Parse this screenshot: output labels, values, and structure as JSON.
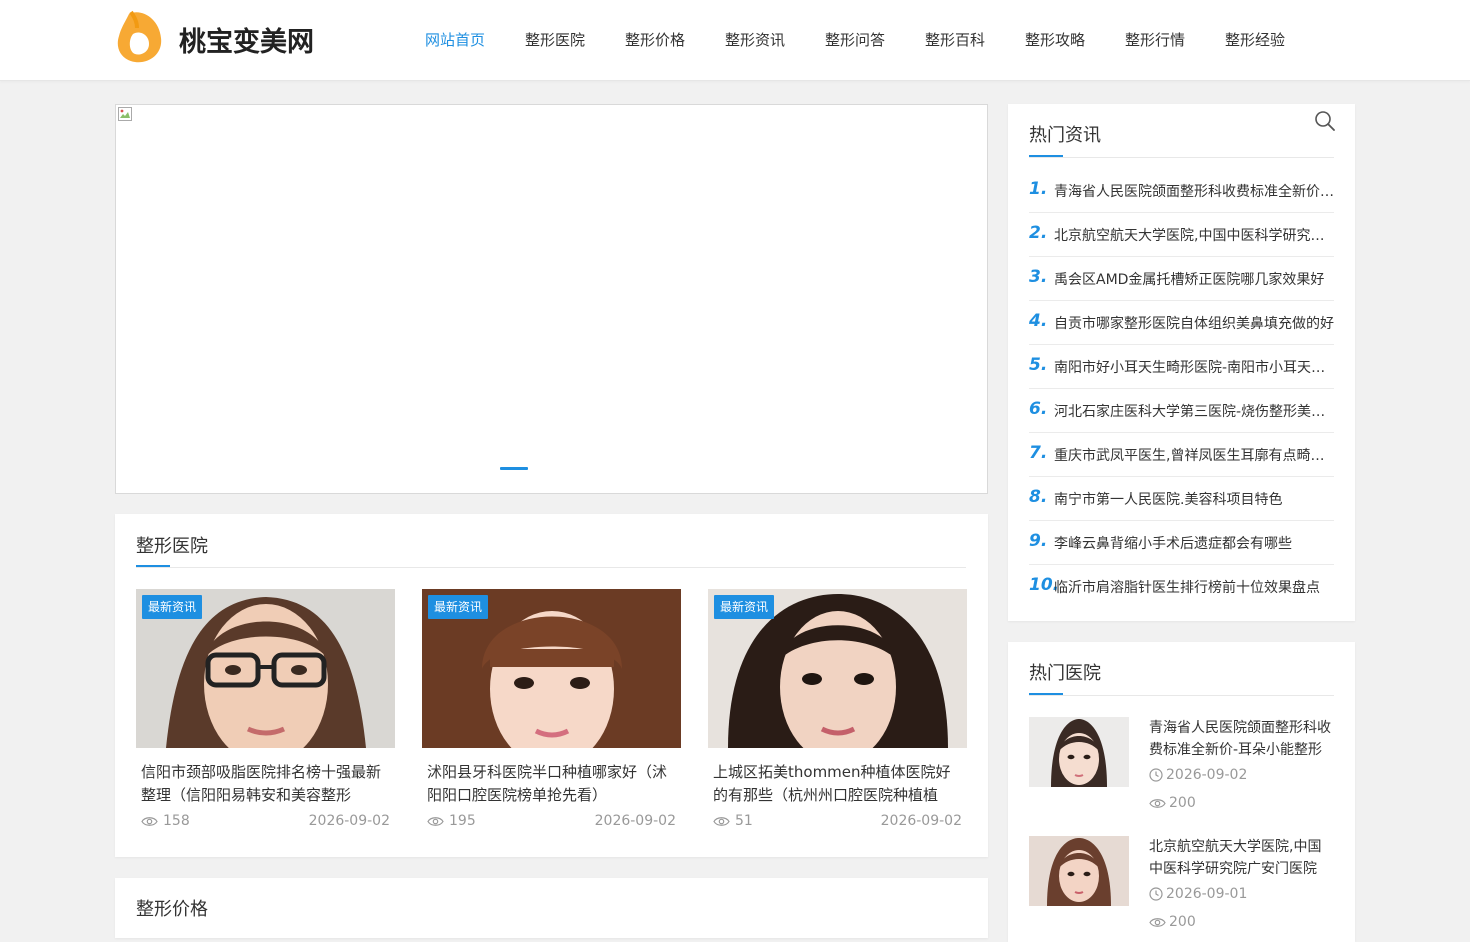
{
  "header": {
    "logo_text": "桃宝变美网",
    "nav": [
      "网站首页",
      "整形医院",
      "整形价格",
      "整形资讯",
      "整形问答",
      "整形百科",
      "整形攻略",
      "整形行情",
      "整形经验"
    ],
    "active_nav": 0
  },
  "colors": {
    "accent": "#1e8fe1",
    "logo_orange": "#f7a934",
    "background": "#f1f1f1"
  },
  "slider": {
    "active_slide": 1
  },
  "hospital_section": {
    "title": "整形医院",
    "articles": [
      {
        "tag": "最新资讯",
        "title": "信阳市颈部吸脂医院排名榜十强最新整理（信阳阳易韩安和美容整形",
        "views": "158",
        "date": "2026-09-02"
      },
      {
        "tag": "最新资讯",
        "title": "沭阳县牙科医院半口种植哪家好（沭阳阳口腔医院榜单抢先看）",
        "views": "195",
        "date": "2026-09-02"
      },
      {
        "tag": "最新资讯",
        "title": "上城区拓美thommen种植体医院好的有那些（杭州州口腔医院种植植",
        "views": "51",
        "date": "2026-09-02"
      }
    ]
  },
  "price_section": {
    "title": "整形价格"
  },
  "hot_news": {
    "title": "热门资讯",
    "search_icon": "search-icon",
    "items": [
      {
        "num": "1.",
        "text": "青海省人民医院颌面整形科收费标准全新价格表"
      },
      {
        "num": "2.",
        "text": "北京航空航天大学医院,中国中医科学研究院广安门医院"
      },
      {
        "num": "3.",
        "text": "禹会区AMD金属托槽矫正医院哪几家效果好"
      },
      {
        "num": "4.",
        "text": "自贡市哪家整形医院自体组织美鼻填充做的好"
      },
      {
        "num": "5.",
        "text": "南阳市好小耳天生畸形医院-南阳市小耳天生畸形医院排名"
      },
      {
        "num": "6.",
        "text": "河北石家庄医科大学第三医院-烧伤整形美容科"
      },
      {
        "num": "7.",
        "text": "重庆市武凤平医生,曾祥凤医生耳廓有点畸形矫正"
      },
      {
        "num": "8.",
        "text": "南宁市第一人民医院.美容科项目特色"
      },
      {
        "num": "9.",
        "text": "李峰云鼻背缩小手术后遗症都会有哪些"
      },
      {
        "num": "10.",
        "text": "临沂市肩溶脂针医生排行榜前十位效果盘点"
      }
    ]
  },
  "hot_hospitals": {
    "title": "热门医院",
    "items": [
      {
        "title": "青海省人民医院颌面整形科收费标准全新价-耳朵小能整形吗",
        "date": "2026-09-02",
        "views": "200"
      },
      {
        "title": "北京航空航天大学医院,中国中医科学研究院广安门医院",
        "date": "2026-09-01",
        "views": "200"
      }
    ]
  }
}
